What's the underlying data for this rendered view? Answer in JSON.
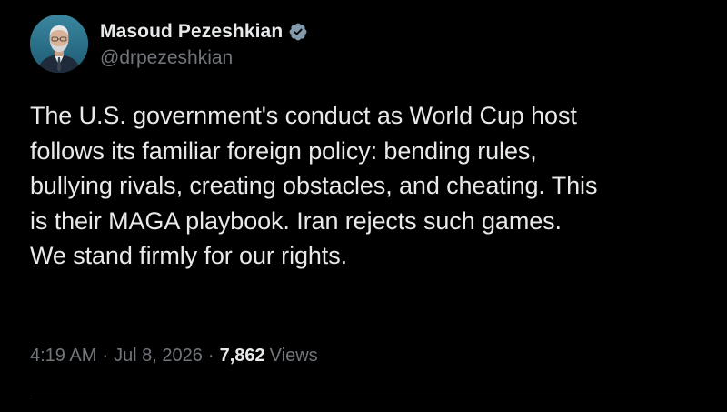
{
  "author": {
    "display_name": "Masoud Pezeshkian",
    "handle": "@drpezeshkian",
    "verified_icon": "verified-badge-icon",
    "avatar_icon": "profile-photo"
  },
  "tweet": {
    "text_lines": [
      "The U.S. government's conduct as World Cup host",
      "follows its familiar foreign policy: bending rules,",
      "bullying rivals, creating obstacles, and cheating. This",
      "is their MAGA playbook. Iran rejects such games.",
      "We stand firmly for our rights."
    ]
  },
  "meta": {
    "time": "4:19 AM",
    "separator": "·",
    "date": "Jul 8, 2026",
    "views_count": "7,862",
    "views_label": "Views"
  },
  "colors": {
    "background": "#000000",
    "primary_text": "#e7e9ea",
    "secondary_text": "#71767b",
    "divider": "#2f3336",
    "verified_badge": "#829aab"
  }
}
